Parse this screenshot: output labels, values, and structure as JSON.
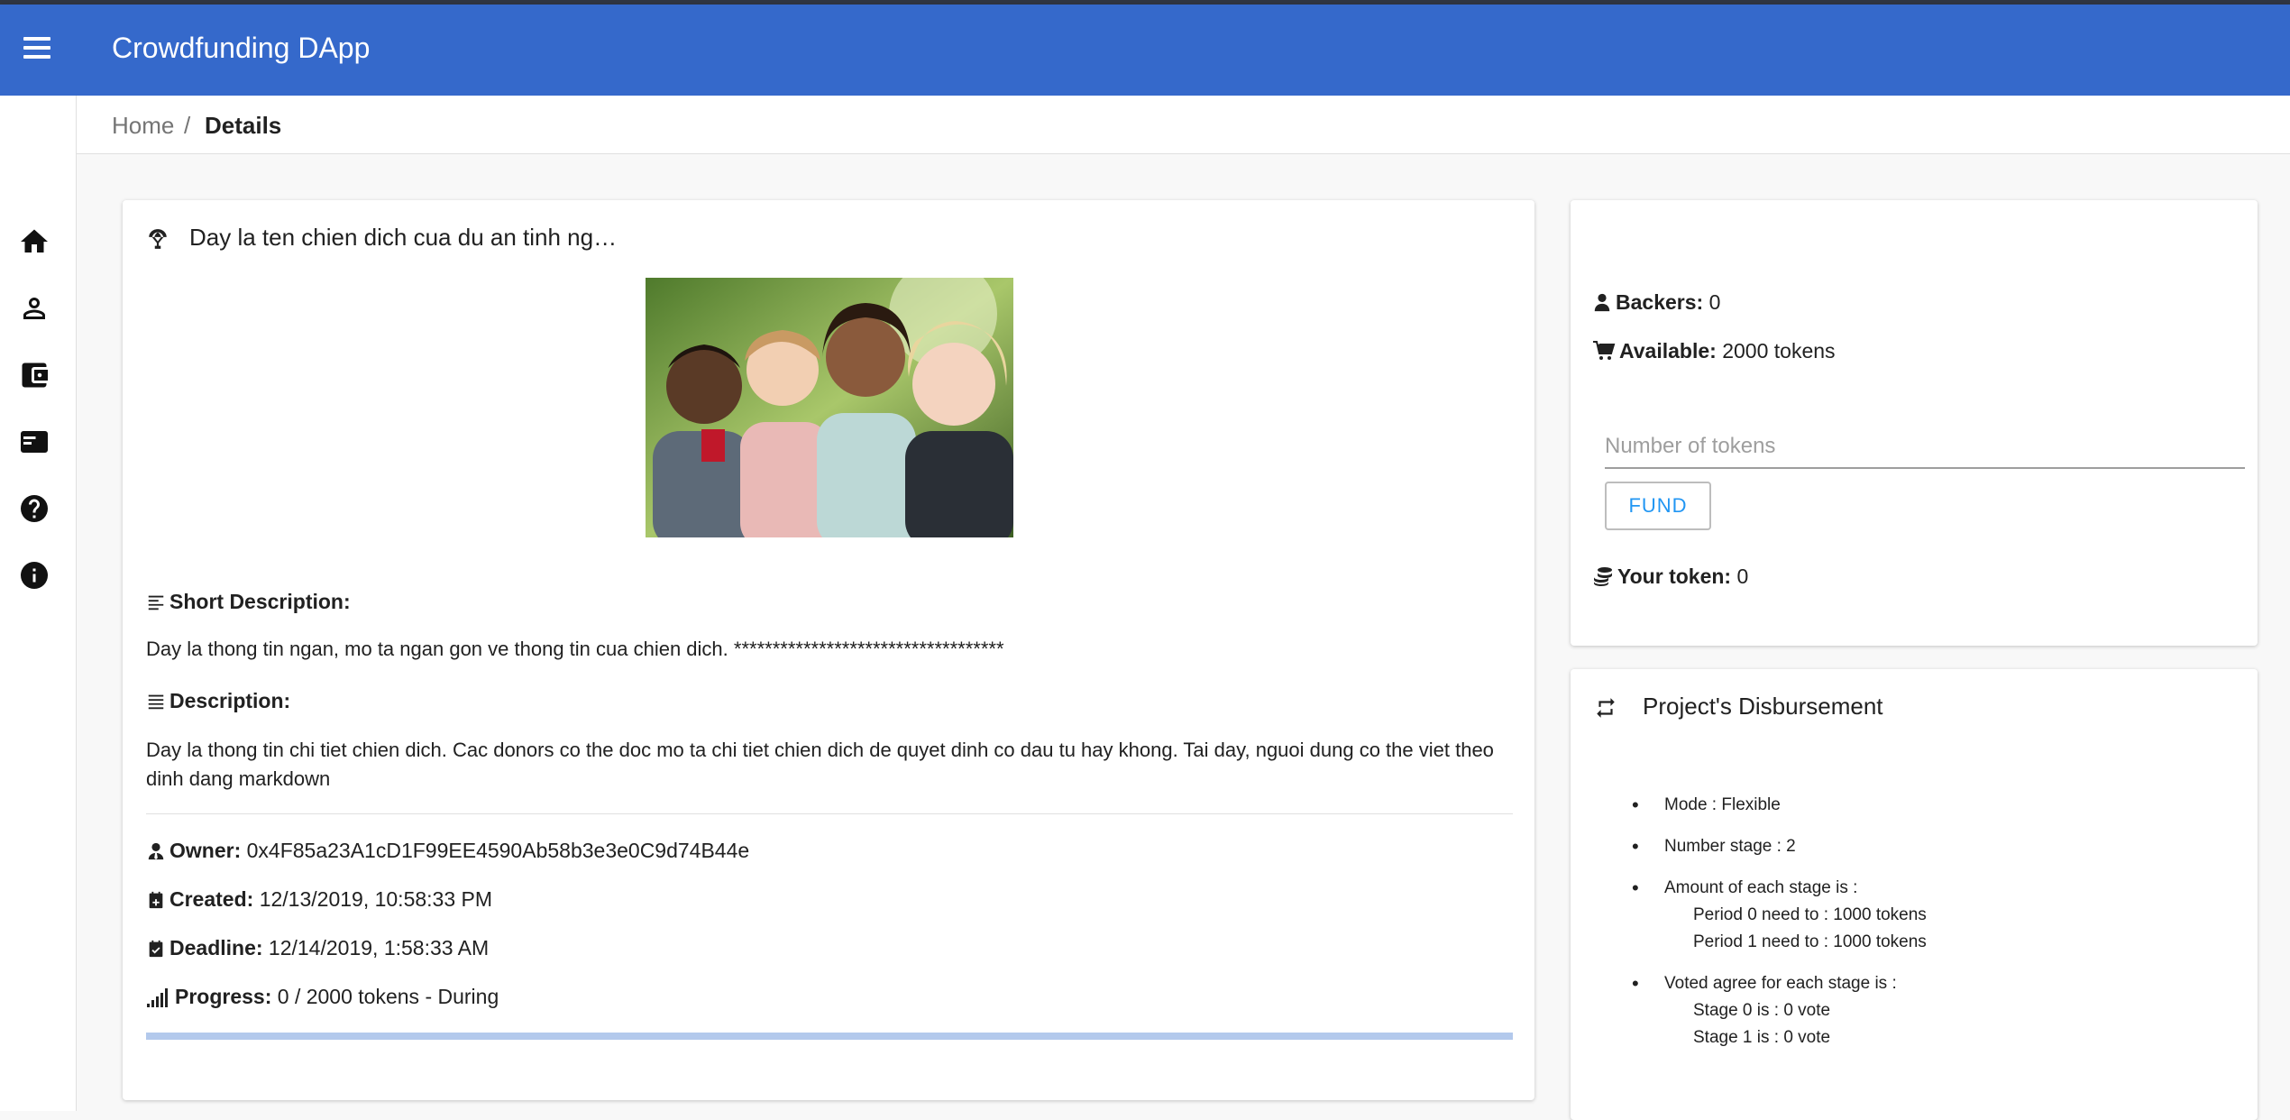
{
  "app": {
    "title": "Crowdfunding DApp"
  },
  "breadcrumb": {
    "home": "Home",
    "separator": "/",
    "current": "Details"
  },
  "nav": [
    "home-icon",
    "person-icon",
    "wallet-icon",
    "card-icon",
    "help-icon",
    "info-icon"
  ],
  "campaign": {
    "title": "Day la ten chien dich cua du an tinh ng…",
    "short_description_label": "Short Description:",
    "short_description": "Day la thong tin ngan, mo ta ngan gon ve thong tin cua chien dich. ***********************************",
    "description_label": "Description:",
    "description": "Day la thong tin chi tiet chien dich. Cac donors co the doc mo ta chi tiet chien dich de quyet dinh co dau tu hay khong. Tai day, nguoi dung co the viet theo dinh dang markdown",
    "owner_label": "Owner:",
    "owner": "0x4F85a23A1cD1F99EE4590Ab58b3e3e0C9d74B44e",
    "created_label": "Created:",
    "created": "12/13/2019, 10:58:33 PM",
    "deadline_label": "Deadline:",
    "deadline": "12/14/2019, 1:58:33 AM",
    "progress_label": "Progress:",
    "progress_text": "0 / 2000 tokens - During",
    "progress_fraction": 0
  },
  "funding": {
    "backers_label": "Backers:",
    "backers": "0",
    "available_label": "Available:",
    "available": "2000 tokens",
    "input_placeholder": "Number of tokens",
    "fund_button": "FUND",
    "your_token_label": "Your token:",
    "your_token": "0"
  },
  "disbursement": {
    "title": "Project's Disbursement",
    "mode": "Mode : Flexible",
    "number_stage": "Number stage : 2",
    "amount_heading": "Amount of each stage is :",
    "periods": [
      "Period 0 need to : 1000 tokens",
      "Period 1 need to : 1000 tokens"
    ],
    "voted_heading": "Voted agree for each stage is :",
    "stages": [
      "Stage 0 is : 0 vote",
      "Stage 1 is : 0 vote"
    ]
  },
  "colors": {
    "appbar": "#3569cb",
    "accent": "#2196f3",
    "progress_track": "#b3c9ec"
  }
}
